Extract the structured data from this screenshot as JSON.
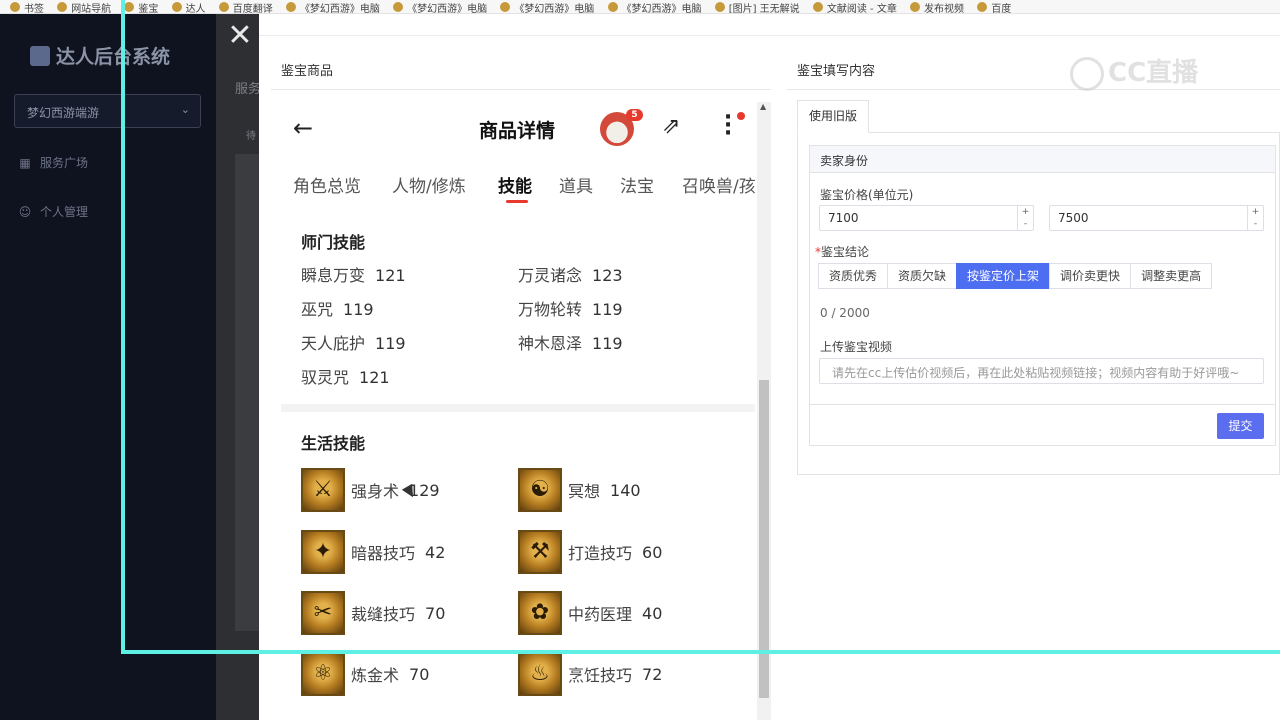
{
  "browser": {
    "bookmarks": [
      "书签",
      "网站导航",
      "鉴宝",
      "达人",
      "百度翻译",
      "《梦幻西游》电脑",
      "《梦幻西游》电脑",
      "《梦幻西游》电脑",
      "《梦幻西游》电脑",
      "[图片] 王无解说",
      "文献阅读 - 文章",
      "发布视频",
      "百度"
    ]
  },
  "sidebar": {
    "logo": "达人后台系统",
    "game_select": "梦幻西游端游",
    "items": [
      {
        "label": "服务广场",
        "icon": "building-icon"
      },
      {
        "label": "个人管理",
        "icon": "user-icon"
      }
    ]
  },
  "main": {
    "tab_hint": "服务",
    "col_hint": "待"
  },
  "drawer": {
    "left_title": "鉴宝商品",
    "right_title": "鉴宝填写内容"
  },
  "phone": {
    "title": "商品详情",
    "badge": "5",
    "tabs": [
      "角色总览",
      "人物/修炼",
      "技能",
      "道具",
      "法宝",
      "召唤兽/孩"
    ],
    "active_tab": "技能",
    "groups": [
      {
        "title": "师门技能",
        "skills": [
          {
            "name": "瞬息万变",
            "level": "121"
          },
          {
            "name": "万灵诸念",
            "level": "123"
          },
          {
            "name": "巫咒",
            "level": "119"
          },
          {
            "name": "万物轮转",
            "level": "119"
          },
          {
            "name": "天人庇护",
            "level": "119"
          },
          {
            "name": "神木恩泽",
            "level": "119"
          },
          {
            "name": "驭灵咒",
            "level": "121"
          }
        ]
      },
      {
        "title": "生活技能",
        "skills": [
          {
            "name": "强身术",
            "level": "129",
            "icon": "strength-skill-icon"
          },
          {
            "name": "冥想",
            "level": "140",
            "icon": "meditation-skill-icon"
          },
          {
            "name": "暗器技巧",
            "level": "42",
            "icon": "dart-skill-icon"
          },
          {
            "name": "打造技巧",
            "level": "60",
            "icon": "forging-skill-icon"
          },
          {
            "name": "裁缝技巧",
            "level": "70",
            "icon": "tailoring-skill-icon"
          },
          {
            "name": "中药医理",
            "level": "40",
            "icon": "herbal-skill-icon"
          },
          {
            "name": "炼金术",
            "level": "70",
            "icon": "alchemy-skill-icon"
          },
          {
            "name": "烹饪技巧",
            "level": "72",
            "icon": "cooking-skill-icon"
          }
        ]
      }
    ]
  },
  "form": {
    "tab_label": "使用旧版",
    "card_title": "卖家身份",
    "price_label": "鉴宝价格(单位元)",
    "price_min": "7100",
    "price_max": "7500",
    "conclusion_label": "鉴宝结论",
    "conclusion_options": [
      "资质优秀",
      "资质欠缺",
      "按鉴定价上架",
      "调价卖更快",
      "调整卖更高"
    ],
    "conclusion_selected": "按鉴定价上架",
    "char_counter": "0 / 2000",
    "video_label": "上传鉴宝视频",
    "video_placeholder": "请先在cc上传估价视频后，再在此处粘贴视频链接；视频内容有助于好评哦~",
    "submit_label": "提交"
  },
  "watermark": "CC直播",
  "colors": {
    "accent": "#4e6ef2",
    "tab_underline": "#e8392d",
    "sidebar_bg": "#0f1320",
    "selection": "#5ef0e4"
  }
}
